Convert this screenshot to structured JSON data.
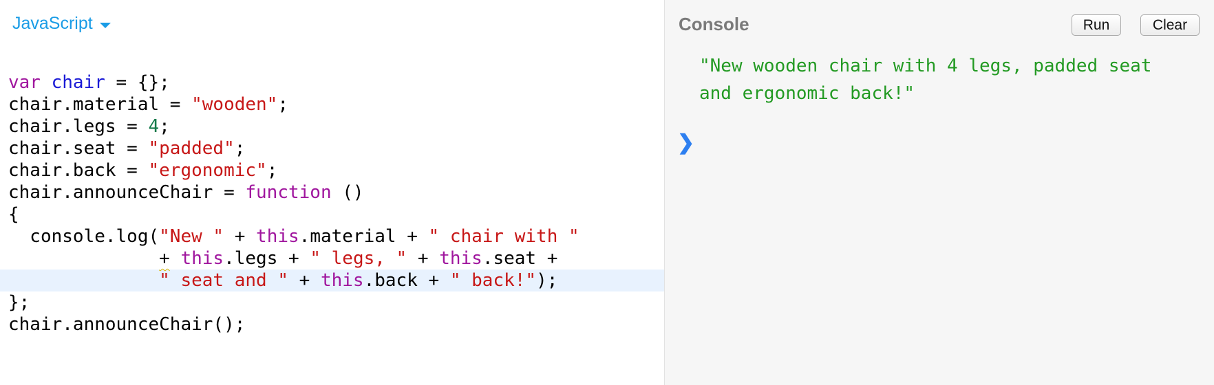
{
  "editor": {
    "language": "JavaScript",
    "lines": [
      [
        {
          "t": "var",
          "c": "kw"
        },
        {
          "t": " "
        },
        {
          "t": "chair",
          "c": "def"
        },
        {
          "t": " = {};"
        }
      ],
      [
        {
          "t": "chair.material = "
        },
        {
          "t": "\"wooden\"",
          "c": "str"
        },
        {
          "t": ";"
        }
      ],
      [
        {
          "t": "chair.legs = "
        },
        {
          "t": "4",
          "c": "num"
        },
        {
          "t": ";"
        }
      ],
      [
        {
          "t": "chair.seat = "
        },
        {
          "t": "\"padded\"",
          "c": "str"
        },
        {
          "t": ";"
        }
      ],
      [
        {
          "t": "chair.back = "
        },
        {
          "t": "\"ergonomic\"",
          "c": "str"
        },
        {
          "t": ";"
        }
      ],
      [
        {
          "t": "chair.announceChair = "
        },
        {
          "t": "function",
          "c": "kw"
        },
        {
          "t": " ()"
        }
      ],
      [
        {
          "t": "{"
        }
      ],
      [
        {
          "t": "  console.log("
        },
        {
          "t": "\"New \"",
          "c": "str"
        },
        {
          "t": " + "
        },
        {
          "t": "this",
          "c": "kw"
        },
        {
          "t": ".material + "
        },
        {
          "t": "\" chair with \"",
          "c": "str"
        }
      ],
      [
        {
          "t": "              "
        },
        {
          "t": "+",
          "c": "squiggle"
        },
        {
          "t": " "
        },
        {
          "t": "this",
          "c": "kw"
        },
        {
          "t": ".legs + "
        },
        {
          "t": "\" legs, \"",
          "c": "str"
        },
        {
          "t": " + "
        },
        {
          "t": "this",
          "c": "kw"
        },
        {
          "t": ".seat +"
        }
      ],
      [
        {
          "t": "              "
        },
        {
          "t": "\" seat and \"",
          "c": "str"
        },
        {
          "t": " + "
        },
        {
          "t": "this",
          "c": "kw"
        },
        {
          "t": ".back + "
        },
        {
          "t": "\" back!\"",
          "c": "str"
        },
        {
          "t": ");"
        }
      ],
      [
        {
          "t": "};"
        }
      ],
      [
        {
          "t": "chair.announceChair();"
        }
      ]
    ],
    "active_line": 9
  },
  "console": {
    "title": "Console",
    "run_label": "Run",
    "clear_label": "Clear",
    "output": "\"New wooden chair with 4 legs, padded seat\nand ergonomic back!\"",
    "prompt_glyph": "❯"
  },
  "colors": {
    "accent": "#1a9ce6",
    "keyword": "#a0169e",
    "definition": "#1a1ad6",
    "string": "#c71717",
    "number": "#147a4a",
    "console_output": "#239a23",
    "prompt": "#2d7ff0"
  }
}
